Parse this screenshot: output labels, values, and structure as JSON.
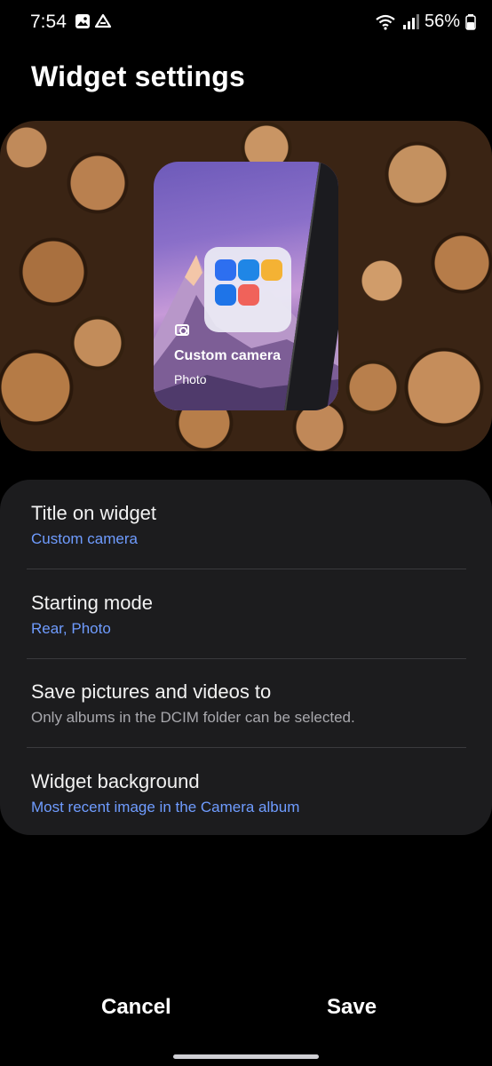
{
  "status_bar": {
    "time": "7:54",
    "battery": "56%",
    "icons": [
      "image-icon",
      "drive-icon",
      "wifi-icon",
      "signal-icon",
      "battery-icon"
    ]
  },
  "header": {
    "title": "Widget settings"
  },
  "preview": {
    "widget_title": "Custom camera",
    "widget_subtitle": "Photo"
  },
  "settings": {
    "items": [
      {
        "label": "Title on widget",
        "value": "Custom camera"
      },
      {
        "label": "Starting mode",
        "value": "Rear, Photo"
      },
      {
        "label": "Save pictures and videos to",
        "value": "Only albums in the DCIM folder can be selected."
      },
      {
        "label": "Widget background",
        "value": "Most recent image in the Camera album"
      }
    ]
  },
  "footer": {
    "cancel_label": "Cancel",
    "save_label": "Save"
  },
  "colors": {
    "accent": "#6f9cff",
    "card_bg": "#1c1c1e",
    "page_bg": "#000000"
  }
}
